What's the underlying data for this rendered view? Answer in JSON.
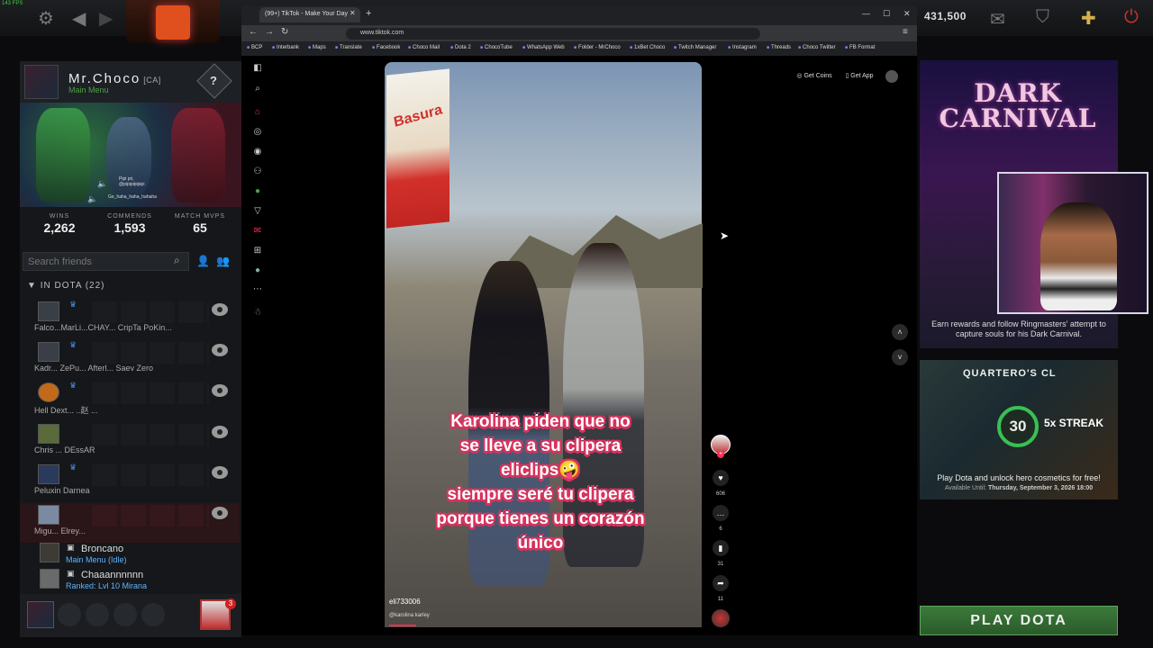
{
  "dota": {
    "fps": "143 FPS",
    "gold": "431,500",
    "profile": {
      "name": "Mr.Choco",
      "tag": "[CA]",
      "status": "Main Menu",
      "rank_mark": "?",
      "hero_chat_line1": "Pipi pri,",
      "hero_chat_line2": "@pipipipipipi",
      "hero_chat_line3": "Ge_haha_haha_hahaha"
    },
    "stats": [
      {
        "label": "WINS",
        "value": "2,262"
      },
      {
        "label": "COMMENDS",
        "value": "1,593"
      },
      {
        "label": "MATCH MVPS",
        "value": "65"
      }
    ],
    "search_placeholder": "Search friends",
    "group_header": "IN DOTA (22)",
    "friend_rows": [
      {
        "names": "Falco...MarLi...CHAY... CripTa PoKin..."
      },
      {
        "names": "Kadr... ZePu... Afterl...   Saev    Zero"
      },
      {
        "names": "Hell    Dext...  ..赵 ..."
      },
      {
        "names": "Chris ... DEssAR"
      },
      {
        "names": "Peluxin Darnea"
      },
      {
        "names": "Migu...  Elrey..."
      }
    ],
    "single_friends": [
      {
        "name": "Broncano",
        "status": "Main Menu (Idle)"
      },
      {
        "name": "Chaaannnnnn",
        "status": "Ranked: Lvl 10 Mirana"
      }
    ],
    "notification_count": "3",
    "dark_carnival": {
      "title": "DARK CARNIVAL",
      "description": "Earn rewards and follow Ringmasters' attempt to capture souls for his Dark Carnival."
    },
    "quartero": {
      "title": "QUARTERO'S CL",
      "streak_number": "30",
      "streak_label": "5x STREAK",
      "description": "Play Dota and unlock hero cosmetics for free!",
      "available_label": "Available Until:",
      "available_date": "Thursday, September 3, 2026 18:00"
    },
    "play_button": "PLAY DOTA"
  },
  "browser": {
    "tab_title": "(99+) TikTok - Make Your Day",
    "url": "www.tiktok.com",
    "bookmarks": [
      "BCP",
      "Interbank",
      "Maps",
      "Translate",
      "Facebook",
      "Choco Mail",
      "Dota 2",
      "ChocoTube",
      "WhatsApp Web",
      "Folder - MrChoco",
      "1xBet Choco",
      "Twitch Manager",
      "Instagram",
      "Threads",
      "Choco Twitter",
      "FB Format"
    ]
  },
  "tiktok": {
    "get_coins": "Get Coins",
    "get_app": "Get App",
    "video_sign_text": "Basura",
    "caption_lines": [
      "Karolina piden que no",
      "se lleve a su clipera",
      "eliclips🤪",
      "siempre seré tu clipera",
      "porque tienes un corazón",
      "único"
    ],
    "username": "eli733006",
    "sound": "@karolina karley",
    "likes": "606",
    "comments": "6",
    "saves": "31",
    "shares": "11"
  }
}
